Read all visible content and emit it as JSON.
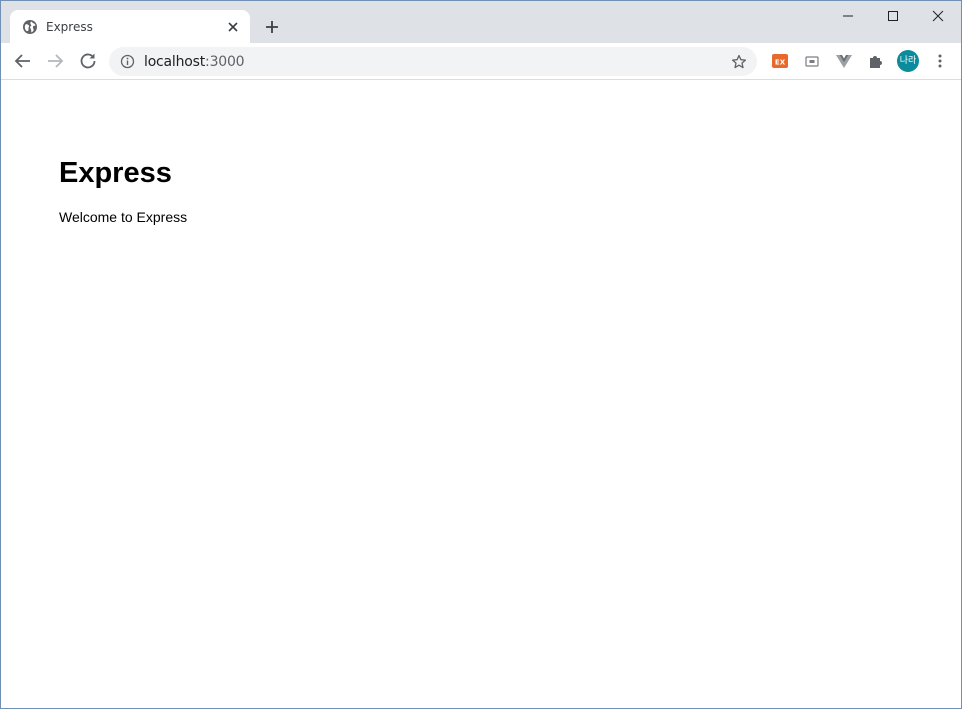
{
  "tab": {
    "title": "Express",
    "favicon": "globe-icon",
    "close_icon": "close-icon"
  },
  "new_tab_icon": "plus-icon",
  "window_controls": [
    "minimize-icon",
    "maximize-icon",
    "close-icon"
  ],
  "toolbar": {
    "back_icon": "arrow-left-icon",
    "forward_icon": "arrow-right-icon",
    "reload_icon": "reload-icon",
    "url_host": "localhost",
    "url_port": ":3000",
    "site_info_icon": "info-icon",
    "bookmark_icon": "star-icon",
    "extensions": [
      {
        "name": "ex-extension-icon",
        "label": "EX",
        "color": "#e8692c"
      },
      {
        "name": "cast-icon"
      },
      {
        "name": "vue-devtools-icon"
      },
      {
        "name": "puzzle-icon"
      }
    ],
    "profile_avatar": "나라",
    "profile_color": "#0b8c9c",
    "menu_icon": "kebab-menu-icon"
  },
  "page": {
    "heading": "Express",
    "text": "Welcome to Express"
  },
  "colors": {
    "tabstrip": "#dee1e6",
    "omnibox": "#f1f3f4",
    "window_border": "#6f8fb5"
  }
}
